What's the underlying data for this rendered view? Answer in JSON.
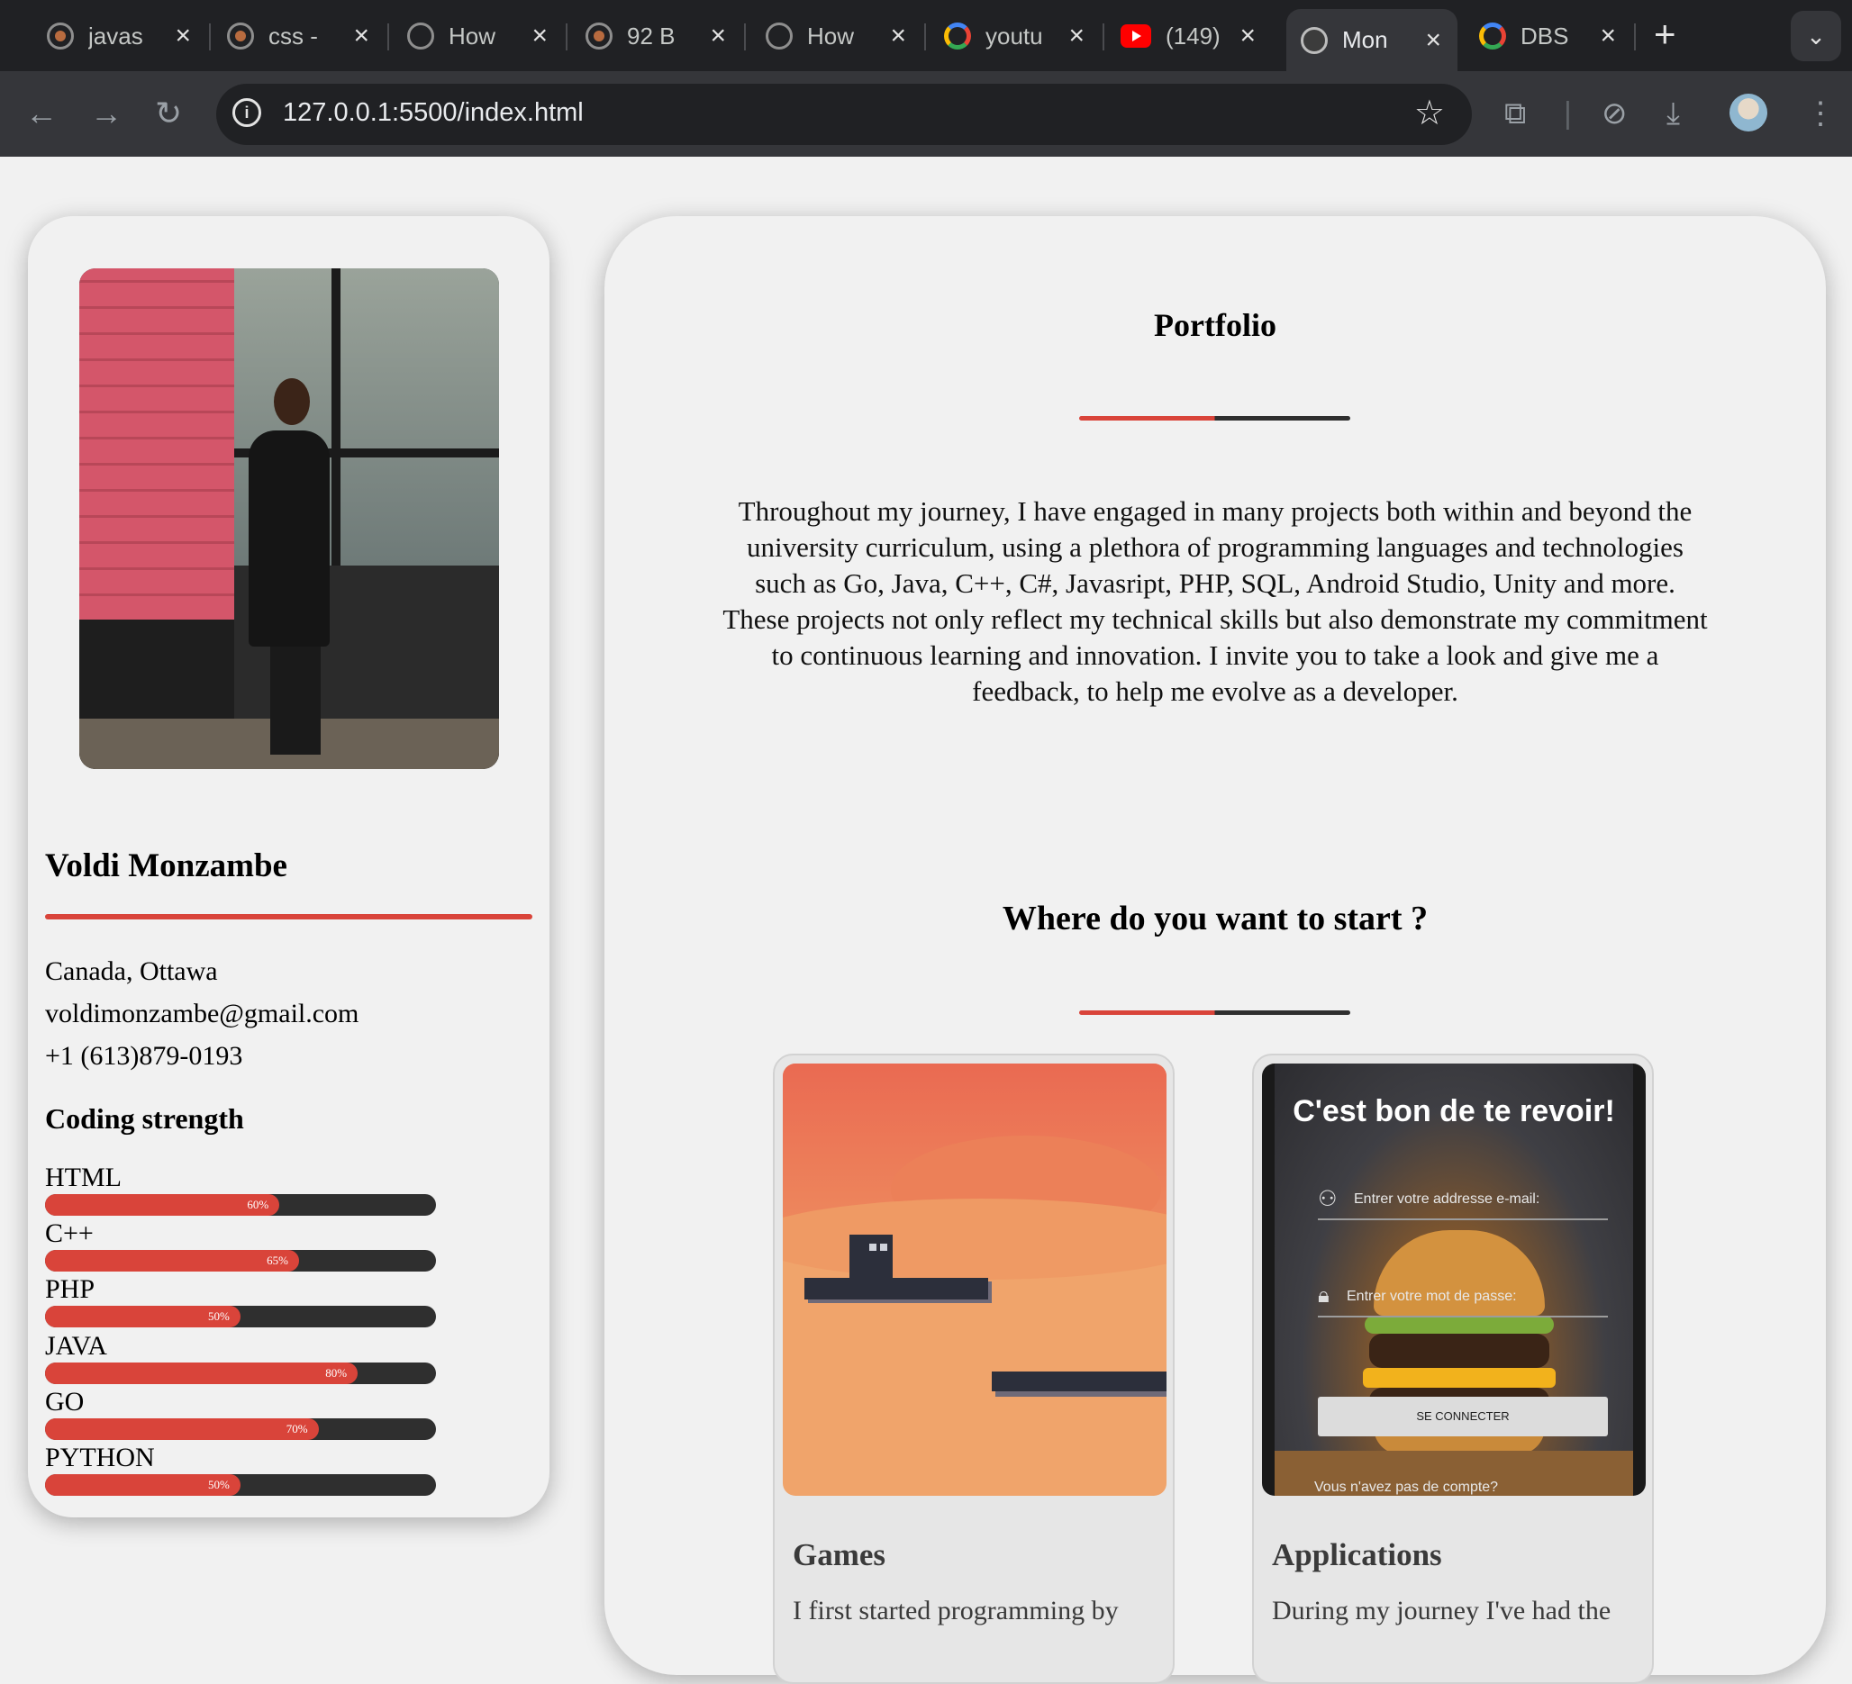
{
  "browser": {
    "tabs": [
      {
        "label": "javas",
        "favicon": "spinner-icon"
      },
      {
        "label": "css -",
        "favicon": "spinner-icon"
      },
      {
        "label": "How",
        "favicon": "flame-icon"
      },
      {
        "label": "92 B",
        "favicon": "spinner-icon"
      },
      {
        "label": "How",
        "favicon": "wp-icon"
      },
      {
        "label": "youtu",
        "favicon": "google-icon"
      },
      {
        "label": "(149)",
        "favicon": "youtube-icon"
      },
      {
        "label": "Mon",
        "favicon": "globe-icon",
        "active": true
      },
      {
        "label": "DBS",
        "favicon": "google-icon"
      }
    ],
    "new_tab": "+",
    "tab_menu": "⌄",
    "url": "127.0.0.1:5500/index.html"
  },
  "profile": {
    "name": "Voldi Monzambe",
    "location": "Canada, Ottawa",
    "email": "voldimonzambe@gmail.com",
    "phone": "+1 (613)879-0193",
    "coding_title": "Coding strength",
    "skills": [
      {
        "name": "HTML",
        "value": 60,
        "label": "60%"
      },
      {
        "name": "C++",
        "value": 65,
        "label": "65%"
      },
      {
        "name": "PHP",
        "value": 50,
        "label": "50%"
      },
      {
        "name": "JAVA",
        "value": 80,
        "label": "80%"
      },
      {
        "name": "GO",
        "value": 70,
        "label": "70%"
      },
      {
        "name": "PYTHON",
        "value": 50,
        "label": "50%"
      }
    ]
  },
  "portfolio": {
    "title": "Portfolio",
    "intro_1": "Throughout my journey, I have engaged in many projects both within and beyond the university curriculum, using a plethora of programming languages and technologies such as Go, Java, C++, C#, Javasript, PHP, SQL, Android Studio, Unity and more.",
    "intro_2": "These projects not only reflect my technical skills but also demonstrate my commitment to continuous learning and innovation. I invite you to take a look and give me a feedback, to help me evolve as a developer.",
    "start_title": "Where do you want to start ?",
    "cards": [
      {
        "title": "Games",
        "desc": "I first started programming by"
      },
      {
        "title": "Applications",
        "desc": "During my journey I've had the"
      }
    ],
    "app_preview": {
      "heading": "C'est bon de te revoir!",
      "email_placeholder": "Entrer votre addresse e-mail:",
      "password_placeholder": "Entrer votre mot de passe:",
      "button": "SE CONNECTER",
      "footer": "Vous n'avez pas de compte?"
    }
  },
  "colors": {
    "accent": "#d9443a",
    "dark": "#2f2f2f",
    "chrome": "#202124"
  }
}
